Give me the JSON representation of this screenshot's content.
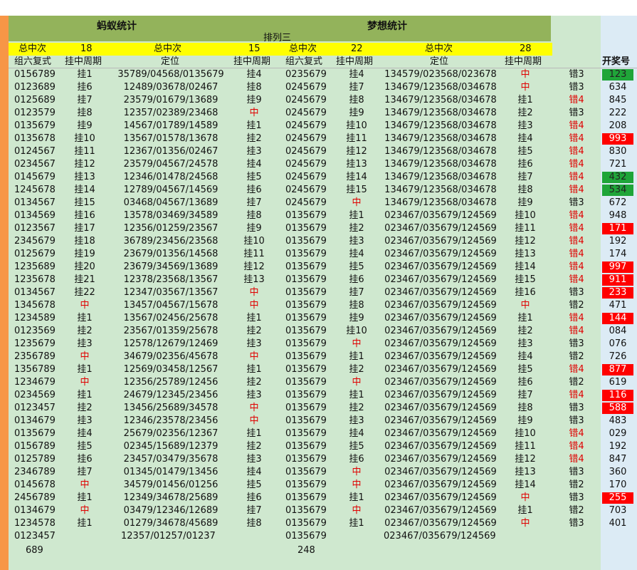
{
  "header": {
    "title_ant": "蚂蚁统计",
    "title_dream": "梦想统计",
    "subtitle": "排列三",
    "summary": [
      {
        "label": "总中次",
        "value": "18"
      },
      {
        "label": "总中次",
        "value": "15"
      },
      {
        "label": "总中次",
        "value": "22"
      },
      {
        "label": "总中次",
        "value": "28"
      }
    ],
    "columns": [
      "组六复式",
      "挂中周期",
      "定位",
      "挂中周期",
      "组六复式",
      "挂中周期",
      "定位",
      "挂中周期",
      "开奖号"
    ]
  },
  "rows": [
    [
      "0156789",
      "挂1",
      "35789/04568/0135679",
      "挂4",
      "0235679",
      "挂4",
      "134579/023568/023678",
      "中",
      "错3",
      "123",
      "g"
    ],
    [
      "0123689",
      "挂6",
      "12489/03678/02467",
      "挂8",
      "0245679",
      "挂7",
      "134679/123568/034678",
      "中",
      "错3",
      "634",
      ""
    ],
    [
      "0125689",
      "挂7",
      "23579/01679/13689",
      "挂9",
      "0245679",
      "挂8",
      "134679/123568/034678",
      "挂1",
      "错4",
      "845",
      ""
    ],
    [
      "0123579",
      "挂8",
      "12357/02389/23468",
      "中",
      "0245679",
      "挂9",
      "134679/123568/034678",
      "挂2",
      "错3",
      "222",
      ""
    ],
    [
      "0135679",
      "挂9",
      "14567/01789/14589",
      "挂1",
      "0245679",
      "挂10",
      "134679/123568/034678",
      "挂3",
      "错4",
      "208",
      ""
    ],
    [
      "0135678",
      "挂10",
      "13567/01578/13678",
      "挂2",
      "0245679",
      "挂11",
      "134679/123568/034678",
      "挂4",
      "错4",
      "993",
      "r"
    ],
    [
      "0124567",
      "挂11",
      "12367/01356/02467",
      "挂3",
      "0245679",
      "挂12",
      "134679/123568/034678",
      "挂5",
      "错4",
      "830",
      ""
    ],
    [
      "0234567",
      "挂12",
      "23579/04567/24578",
      "挂4",
      "0245679",
      "挂13",
      "134679/123568/034678",
      "挂6",
      "错4",
      "721",
      ""
    ],
    [
      "0145679",
      "挂13",
      "12346/01478/24568",
      "挂5",
      "0245679",
      "挂14",
      "134679/123568/034678",
      "挂7",
      "错4",
      "432",
      "g"
    ],
    [
      "1245678",
      "挂14",
      "12789/04567/14569",
      "挂6",
      "0245679",
      "挂15",
      "134679/123568/034678",
      "挂8",
      "错4",
      "534",
      "g"
    ],
    [
      "0134567",
      "挂15",
      "03468/04567/13689",
      "挂7",
      "0245679",
      "中",
      "134679/123568/034678",
      "挂9",
      "错3",
      "672",
      ""
    ],
    [
      "0134569",
      "挂16",
      "13578/03469/34589",
      "挂8",
      "0135679",
      "挂1",
      "023467/035679/124569",
      "挂10",
      "错4",
      "948",
      ""
    ],
    [
      "0123567",
      "挂17",
      "12356/01259/23567",
      "挂9",
      "0135679",
      "挂2",
      "023467/035679/124569",
      "挂11",
      "错4",
      "171",
      "r"
    ],
    [
      "2345679",
      "挂18",
      "36789/23456/23568",
      "挂10",
      "0135679",
      "挂3",
      "023467/035679/124569",
      "挂12",
      "错4",
      "192",
      ""
    ],
    [
      "0125679",
      "挂19",
      "23679/01356/14568",
      "挂11",
      "0135679",
      "挂4",
      "023467/035679/124569",
      "挂13",
      "错4",
      "174",
      ""
    ],
    [
      "1235689",
      "挂20",
      "23679/34569/13689",
      "挂12",
      "0135679",
      "挂5",
      "023467/035679/124569",
      "挂14",
      "错4",
      "997",
      "r"
    ],
    [
      "1235678",
      "挂21",
      "12378/23568/13567",
      "挂13",
      "0135679",
      "挂6",
      "023467/035679/124569",
      "挂15",
      "错4",
      "911",
      "r"
    ],
    [
      "0134567",
      "挂22",
      "12347/03567/13567",
      "中",
      "0135679",
      "挂7",
      "023467/035679/124569",
      "挂16",
      "错3",
      "233",
      "r"
    ],
    [
      "1345678",
      "中",
      "13457/04567/15678",
      "中",
      "0135679",
      "挂8",
      "023467/035679/124569",
      "中",
      "错2",
      "471",
      ""
    ],
    [
      "1234589",
      "挂1",
      "13567/02456/25678",
      "挂1",
      "0135679",
      "挂9",
      "023467/035679/124569",
      "挂1",
      "错4",
      "144",
      "r"
    ],
    [
      "0123569",
      "挂2",
      "23567/01359/25678",
      "挂2",
      "0135679",
      "挂10",
      "023467/035679/124569",
      "挂2",
      "错4",
      "084",
      ""
    ],
    [
      "1235679",
      "挂3",
      "12578/12679/12469",
      "挂3",
      "0135679",
      "中",
      "023467/035679/124569",
      "挂3",
      "错3",
      "076",
      ""
    ],
    [
      "2356789",
      "中",
      "34679/02356/45678",
      "中",
      "0135679",
      "挂1",
      "023467/035679/124569",
      "挂4",
      "错2",
      "726",
      ""
    ],
    [
      "1356789",
      "挂1",
      "12569/03458/12567",
      "挂1",
      "0135679",
      "挂2",
      "023467/035679/124569",
      "挂5",
      "错4",
      "877",
      "r"
    ],
    [
      "1234679",
      "中",
      "12356/25789/12456",
      "挂2",
      "0135679",
      "中",
      "023467/035679/124569",
      "挂6",
      "错2",
      "619",
      ""
    ],
    [
      "0234569",
      "挂1",
      "24679/12345/23456",
      "挂3",
      "0135679",
      "挂1",
      "023467/035679/124569",
      "挂7",
      "错4",
      "116",
      "r"
    ],
    [
      "0123457",
      "挂2",
      "13456/25689/34578",
      "中",
      "0135679",
      "挂2",
      "023467/035679/124569",
      "挂8",
      "错3",
      "588",
      "r"
    ],
    [
      "0134679",
      "挂3",
      "12346/23578/23456",
      "中",
      "0135679",
      "挂3",
      "023467/035679/124569",
      "挂9",
      "错3",
      "483",
      ""
    ],
    [
      "0135679",
      "挂4",
      "25679/02356/12367",
      "挂1",
      "0135679",
      "挂4",
      "023467/035679/124569",
      "挂10",
      "错4",
      "029",
      ""
    ],
    [
      "0156789",
      "挂5",
      "02345/15689/12379",
      "挂2",
      "0135679",
      "挂5",
      "023467/035679/124569",
      "挂11",
      "错4",
      "192",
      ""
    ],
    [
      "0125789",
      "挂6",
      "23457/03479/35678",
      "挂3",
      "0135679",
      "挂6",
      "023467/035679/124569",
      "挂12",
      "错4",
      "847",
      ""
    ],
    [
      "2346789",
      "挂7",
      "01345/01479/13456",
      "挂4",
      "0135679",
      "中",
      "023467/035679/124569",
      "挂13",
      "错3",
      "360",
      ""
    ],
    [
      "0145678",
      "中",
      "34579/01456/01256",
      "挂5",
      "0135679",
      "中",
      "023467/035679/124569",
      "挂14",
      "错2",
      "170",
      ""
    ],
    [
      "2456789",
      "挂1",
      "12349/34678/25689",
      "挂6",
      "0135679",
      "挂1",
      "023467/035679/124569",
      "中",
      "错3",
      "255",
      "r"
    ],
    [
      "0134679",
      "中",
      "03479/12346/12689",
      "挂7",
      "0135679",
      "中",
      "023467/035679/124569",
      "挂1",
      "错2",
      "703",
      ""
    ],
    [
      "1234578",
      "挂1",
      "01279/34678/45689",
      "挂8",
      "0135679",
      "挂1",
      "023467/035679/124569",
      "中",
      "错3",
      "401",
      ""
    ]
  ],
  "footer": {
    "a": "0123457",
    "a2": "689",
    "b": "12357/01257/01237",
    "c": "0135679",
    "c2": "248",
    "d": "023467/035679/124569"
  },
  "colors": {
    "accent_orange": "#f79646",
    "header_green": "#93b35b",
    "sheet_green": "#cfe8cf",
    "highlight_red": "#ff0000",
    "highlight_green": "#1fa539"
  }
}
